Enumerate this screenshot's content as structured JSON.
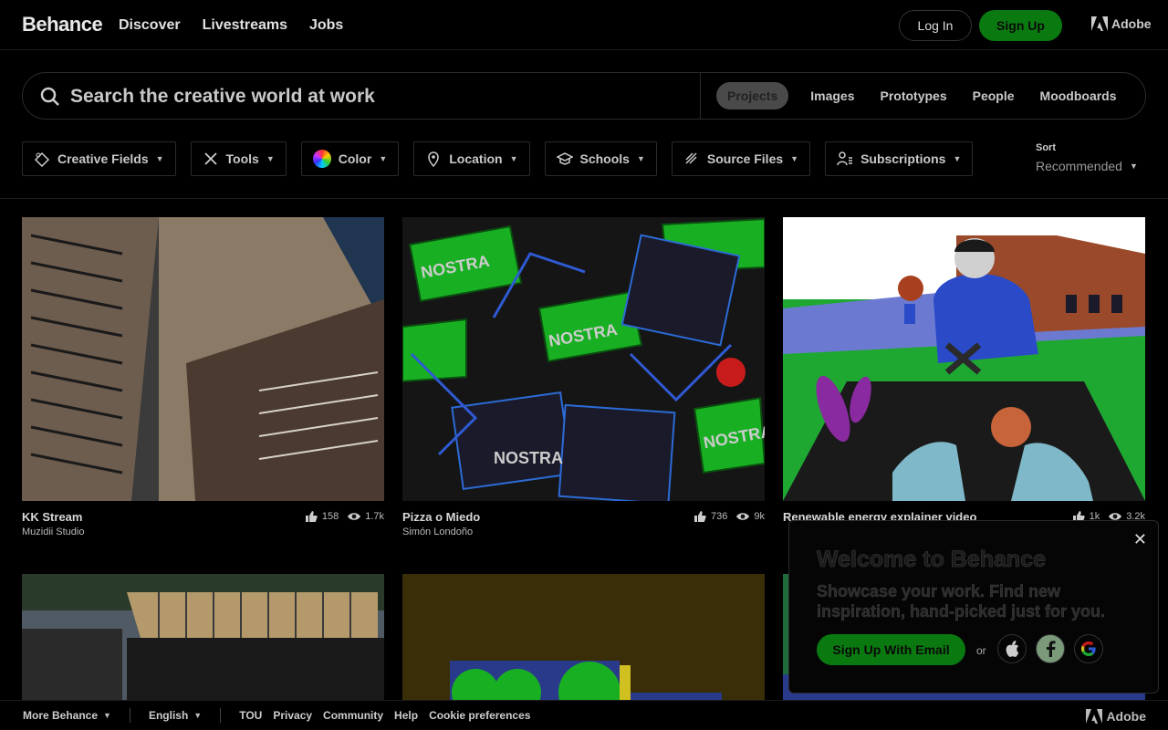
{
  "header": {
    "logo": "Behance",
    "nav": [
      "Discover",
      "Livestreams",
      "Jobs"
    ],
    "login_label": "Log In",
    "signup_label": "Sign Up",
    "adobe_label": "Adobe"
  },
  "search": {
    "placeholder": "Search the creative world at work",
    "tabs": [
      "Projects",
      "Images",
      "Prototypes",
      "People",
      "Moodboards"
    ],
    "active_tab": "Projects"
  },
  "filters": [
    "Creative Fields",
    "Tools",
    "Color",
    "Location",
    "Schools",
    "Source Files",
    "Subscriptions"
  ],
  "sort": {
    "label": "Sort",
    "value": "Recommended"
  },
  "projects": [
    {
      "title": "KK Stream",
      "author": "Muzidii Studio",
      "likes": "158",
      "views": "1.7k"
    },
    {
      "title": "Pizza o Miedo",
      "author": "Simón Londoño",
      "likes": "736",
      "views": "9k"
    },
    {
      "title": "Renewable energy explainer video",
      "author": "",
      "likes": "1k",
      "views": "3.2k"
    }
  ],
  "welcome": {
    "title": "Welcome to Behance",
    "subtitle": "Showcase your work. Find new inspiration, hand-picked just for you.",
    "email_button": "Sign Up With Email",
    "or": "or"
  },
  "footer": {
    "more": "More Behance",
    "language": "English",
    "links": [
      "TOU",
      "Privacy",
      "Community",
      "Help",
      "Cookie preferences"
    ],
    "adobe_label": "Adobe"
  },
  "colors": {
    "accent": "#0a7a10",
    "background": "#000000"
  }
}
